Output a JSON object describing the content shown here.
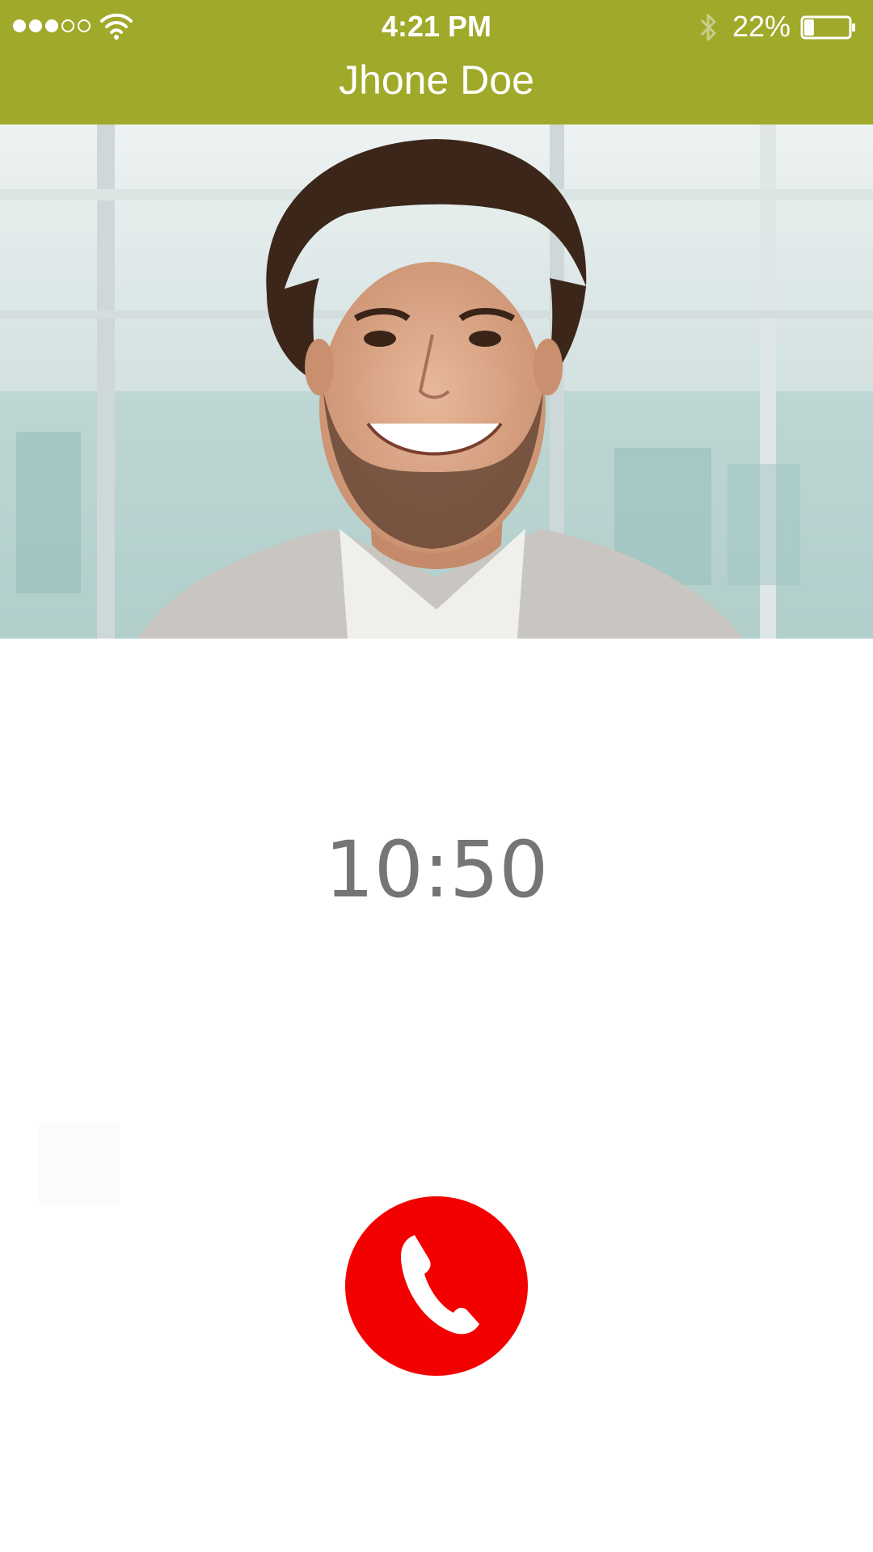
{
  "status_bar": {
    "signal_dots_filled": 3,
    "signal_dots_total": 5,
    "wifi_icon": "wifi-icon",
    "time": "4:21 PM",
    "bluetooth_icon": "bluetooth-icon",
    "battery_percent": "22%",
    "battery_level": 0.22,
    "battery_icon": "battery-icon"
  },
  "header": {
    "title": "Jhone Doe",
    "background_color": "#a0a929"
  },
  "call": {
    "photo": "contact-photo",
    "duration": "10:50",
    "end_button_icon": "phone-hangup-icon",
    "end_button_color": "#f30000"
  }
}
